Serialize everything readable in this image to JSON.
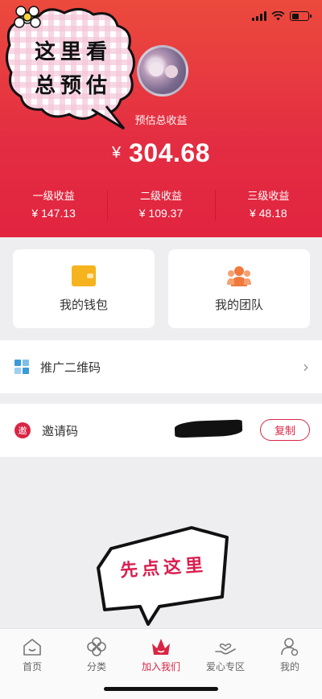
{
  "header": {
    "estimate_label": "预估总收益",
    "currency": "¥",
    "total": "304.68",
    "levels": [
      {
        "title": "一级收益",
        "value": "¥ 147.13"
      },
      {
        "title": "二级收益",
        "value": "¥ 109.37"
      },
      {
        "title": "三级收益",
        "value": "¥ 48.18"
      }
    ]
  },
  "stickers": {
    "top_line1": "这里看",
    "top_line2": "总预估",
    "bottom": "先点这里"
  },
  "cards": {
    "wallet": {
      "label": "我的钱包",
      "icon": "wallet-icon"
    },
    "team": {
      "label": "我的团队",
      "icon": "team-icon"
    }
  },
  "promo_qr": {
    "label": "推广二维码",
    "icon": "qr-code-icon"
  },
  "invite": {
    "label": "邀请码",
    "icon_text": "邀",
    "copy_label": "复制"
  },
  "tabbar": {
    "items": [
      {
        "label": "首页",
        "icon": "home-icon"
      },
      {
        "label": "分类",
        "icon": "category-icon"
      },
      {
        "label": "加入我们",
        "icon": "crown-icon"
      },
      {
        "label": "爱心专区",
        "icon": "heart-hand-icon"
      },
      {
        "label": "我的",
        "icon": "user-icon"
      }
    ],
    "active_index": 2
  },
  "colors": {
    "header_red": "#e32d42",
    "accent": "#d92544",
    "wallet_yellow": "#f5b31d",
    "team_orange": "#f07a3d"
  }
}
